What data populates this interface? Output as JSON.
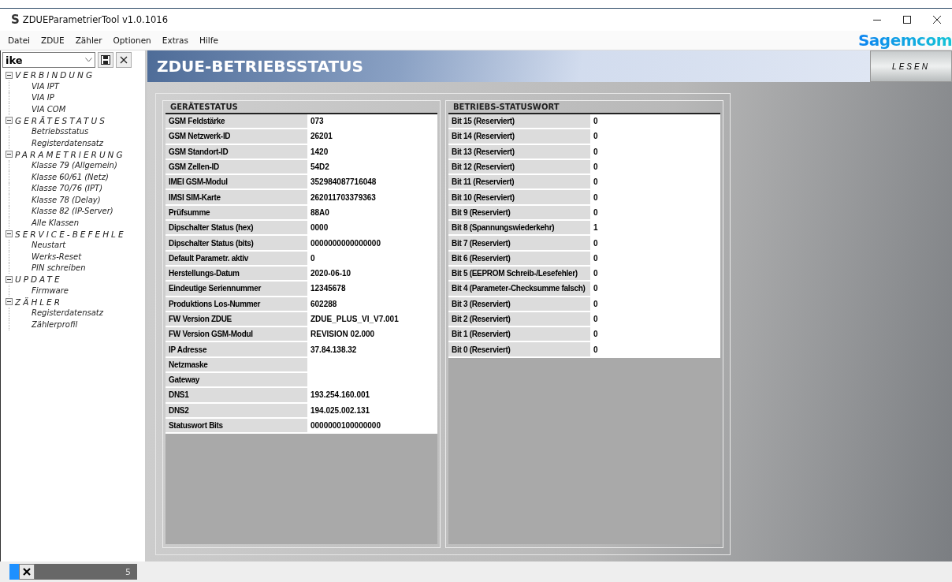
{
  "window": {
    "title": "ZDUEParametrierTool v1.0.1016",
    "logo": "S"
  },
  "menu": [
    "Datei",
    "ZDUE",
    "Zähler",
    "Optionen",
    "Extras",
    "Hilfe"
  ],
  "brand": "Sagemcom",
  "profile": {
    "value": "ike"
  },
  "tree": [
    {
      "label": "VERBINDUNG",
      "expanded": true,
      "children": [
        {
          "label": "VIA IPT"
        },
        {
          "label": "VIA IP"
        },
        {
          "label": "VIA COM"
        }
      ]
    },
    {
      "label": "GERÄTESTATUS",
      "expanded": true,
      "children": [
        {
          "label": "Betriebsstatus"
        },
        {
          "label": "Registerdatensatz"
        }
      ]
    },
    {
      "label": "PARAMETRIERUNG",
      "expanded": true,
      "children": [
        {
          "label": "Klasse 79 (Allgemein)"
        },
        {
          "label": "Klasse 60/61 (Netz)"
        },
        {
          "label": "Klasse 70/76 (IPT)"
        },
        {
          "label": "Klasse 78 (Delay)"
        },
        {
          "label": "Klasse 82 (IP-Server)"
        },
        {
          "label": "Alle Klassen"
        }
      ]
    },
    {
      "label": "SERVICE-BEFEHLE",
      "expanded": true,
      "children": [
        {
          "label": "Neustart"
        },
        {
          "label": "Werks-Reset"
        },
        {
          "label": "PIN schreiben"
        }
      ]
    },
    {
      "label": "UPDATE",
      "expanded": true,
      "children": [
        {
          "label": "Firmware"
        }
      ]
    },
    {
      "label": "ZÄHLER",
      "expanded": true,
      "children": [
        {
          "label": "Registerdatensatz"
        },
        {
          "label": "Zählerprofil"
        }
      ]
    }
  ],
  "page_title": "ZDUE-BETRIEBSSTATUS",
  "read_button": "LESEN",
  "groups": [
    {
      "title": "GERÄTESTATUS",
      "rows": [
        [
          "GSM Feldstärke",
          "073"
        ],
        [
          "GSM Netzwerk-ID",
          "26201"
        ],
        [
          "GSM Standort-ID",
          "1420"
        ],
        [
          "GSM Zellen-ID",
          "54D2"
        ],
        [
          "IMEI GSM-Modul",
          "352984087716048"
        ],
        [
          "IMSI SIM-Karte",
          "262011703379363"
        ],
        [
          "Prüfsumme",
          "88A0"
        ],
        [
          "Dipschalter Status (hex)",
          "0000"
        ],
        [
          "Dipschalter Status (bits)",
          "0000000000000000"
        ],
        [
          "Default Parametr. aktiv",
          "0"
        ],
        [
          "Herstellungs-Datum",
          "2020-06-10"
        ],
        [
          "Eindeutige Seriennummer",
          "12345678"
        ],
        [
          "Produktions Los-Nummer",
          "602288"
        ],
        [
          "FW Version ZDUE",
          "ZDUE_PLUS_VI_V7.001"
        ],
        [
          "FW Version GSM-Modul",
          "REVISION 02.000"
        ],
        [
          "IP Adresse",
          "37.84.138.32"
        ],
        [
          "Netzmaske",
          ""
        ],
        [
          "Gateway",
          ""
        ],
        [
          "DNS1",
          "193.254.160.001"
        ],
        [
          "DNS2",
          "194.025.002.131"
        ],
        [
          "Statuswort Bits",
          "0000000100000000"
        ]
      ]
    },
    {
      "title": "BETRIEBS-STATUSWORT",
      "rows": [
        [
          "Bit 15 (Reserviert)",
          "0"
        ],
        [
          "Bit 14 (Reserviert)",
          "0"
        ],
        [
          "Bit 13 (Reserviert)",
          "0"
        ],
        [
          "Bit 12 (Reserviert)",
          "0"
        ],
        [
          "Bit 11 (Reserviert)",
          "0"
        ],
        [
          "Bit 10 (Reserviert)",
          "0"
        ],
        [
          "Bit 9 (Reserviert)",
          "0"
        ],
        [
          "Bit 8 (Spannungswiederkehr)",
          "1"
        ],
        [
          "Bit 7 (Reserviert)",
          "0"
        ],
        [
          "Bit 6 (Reserviert)",
          "0"
        ],
        [
          "Bit 5 (EEPROM Schreib-/Lesefehler)",
          "0"
        ],
        [
          "Bit 4 (Parameter-Checksumme falsch)",
          "0"
        ],
        [
          "Bit 3 (Reserviert)",
          "0"
        ],
        [
          "Bit 2 (Reserviert)",
          "0"
        ],
        [
          "Bit 1 (Reserviert)",
          "0"
        ],
        [
          "Bit 0 (Reserviert)",
          "0"
        ]
      ]
    }
  ],
  "status_bar": {
    "count": "5"
  }
}
